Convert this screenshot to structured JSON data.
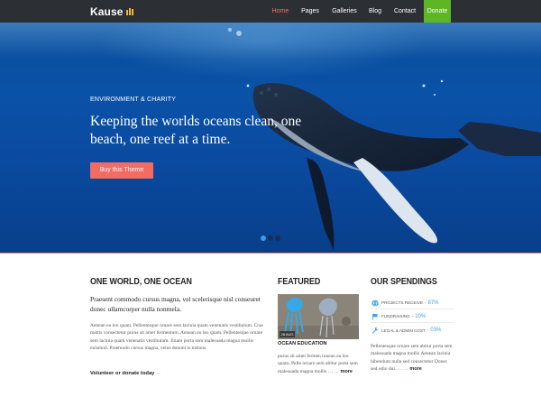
{
  "nav": {
    "logo": "Kause",
    "items": [
      "Home",
      "Pages",
      "Galleries",
      "Blog",
      "Contact"
    ],
    "donate": "Donate"
  },
  "hero": {
    "kicker": "ENVIRONMENT & CHARITY",
    "title": "Keeping the worlds oceans clean, one beach, one reef at a time.",
    "button": "Buy this Theme",
    "active_slide": 1,
    "slide_count": 3
  },
  "ocean": {
    "title": "ONE WORLD, ONE OCEAN",
    "lead": "Praesent commodo cursus magna, vel scelerisque nisl conseuret donec ullamcorper nulla nonmela.",
    "body": "Aenean eu leo quam. Pellentesque ornare sem lacinia quam venenatis vestibulum. Cras mattis consectetur purus sit amet fermentum. Aenean eu leo quam. Pellentesque ornare sem lacinia quam venenatis vestibulum. Etiam porta sem malesuada magna mollis euismod. Praemodo cursus magna, velus donont is nislons.",
    "link": "Volunteer or donate today",
    "link_arrow": "→"
  },
  "featured": {
    "title": "FEATURED",
    "date": "28 AUG",
    "post_title": "OCEAN EDUCATION",
    "text": "purus sit amet fermen tunean eu leo quam. Pelle ornare sem abitur porta sem malesuada magna mollis …",
    "arrow": "→",
    "more": "more"
  },
  "spendings": {
    "title": "OUR SPENDINGS",
    "rows": [
      {
        "label": "PROJECTS RECEIVE",
        "value": "87%",
        "icon": "globe-icon"
      },
      {
        "label": "FUNDRAISING",
        "value": "10%",
        "icon": "flag-icon"
      },
      {
        "label": "LEGAL & ADMIN COST",
        "value": "03%",
        "icon": "wrench-icon"
      }
    ],
    "separator": "-",
    "text": "Pellentesque ornare sem abitur porta sem malesuada magna mollis Aenean lacinia bibendum nulla sed consectetur Donec sed odio dui. …",
    "arrow": "→",
    "more": "more"
  },
  "colors": {
    "nav_bg": "#2c2f34",
    "active_link": "#ff6a5c",
    "donate": "#5eb624",
    "hero_button": "#f26c63",
    "accent_blue": "#3aa6e6",
    "ocean": "#0a4d99"
  }
}
